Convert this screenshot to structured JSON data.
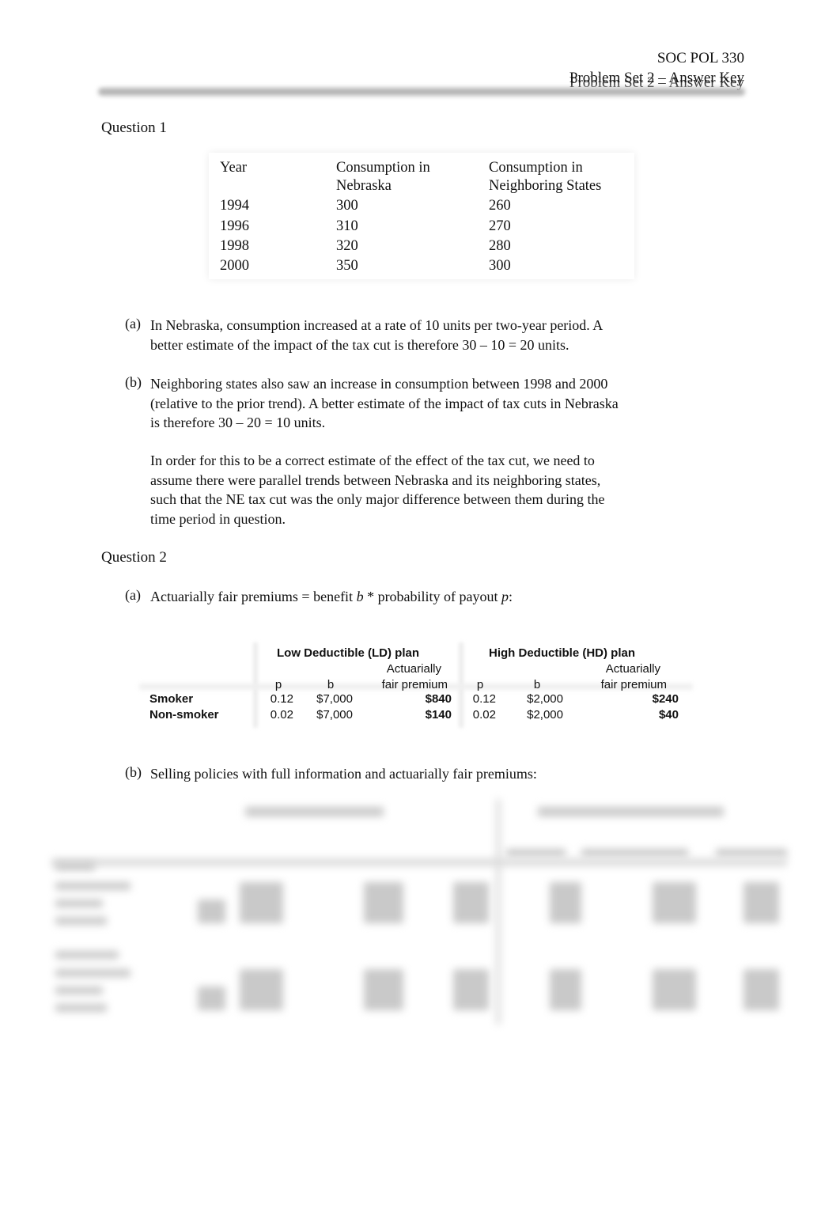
{
  "header": {
    "course": "SOC POL 330",
    "title": "Problem Set 2 – Answer Key"
  },
  "question1": {
    "heading": "Question 1",
    "table": {
      "columns": [
        "Year",
        "Consumption in\nNebraska",
        "Consumption in\nNeighboring States"
      ],
      "column_lines": [
        [
          "Year"
        ],
        [
          "Consumption in",
          "Nebraska"
        ],
        [
          "Consumption in",
          "Neighboring States"
        ]
      ],
      "rows": [
        [
          "1994",
          "300",
          "260"
        ],
        [
          "1996",
          "310",
          "270"
        ],
        [
          "1998",
          "320",
          "280"
        ],
        [
          "2000",
          "350",
          "300"
        ]
      ]
    },
    "part_a": {
      "label": "(a)",
      "lines": [
        "In Nebraska, consumption increased at a rate of 10 units per two-year period. A",
        "better estimate of the impact of the tax cut is therefore 30 – 10 = 20 units."
      ]
    },
    "part_b": {
      "label": "(b)",
      "lines": [
        "Neighboring states also saw an increase in consumption between 1998 and 2000",
        "(relative to the prior trend). A better estimate of the impact of tax cuts in Nebraska",
        "is therefore 30 – 20 = 10 units."
      ],
      "followup_lines": [
        "In order for this to be a correct estimate of the effect of the tax cut, we need to",
        "assume there were parallel trends between Nebraska and its neighboring states,",
        "such that the NE tax cut was the only major difference between them during the",
        "time period in question."
      ]
    }
  },
  "question2": {
    "heading": "Question 2",
    "part_a": {
      "label": "(a)",
      "text_pre": "Actuarially fair premiums = benefit ",
      "var_b": "b",
      "text_mid": " * probability of payout ",
      "var_p": "p",
      "text_post": ":"
    },
    "premium_table": {
      "groups": [
        "Low Deductible (LD) plan",
        "High Deductible (HD) plan"
      ],
      "subheaders": {
        "p": "p",
        "b": "b",
        "premium_line1": "Actuarially",
        "premium_line2": "fair premium"
      },
      "rows": [
        {
          "label": "Smoker",
          "ld": {
            "p": "0.12",
            "b": "$7,000",
            "premium": "$840"
          },
          "hd": {
            "p": "0.12",
            "b": "$2,000",
            "premium": "$240"
          }
        },
        {
          "label": "Non-smoker",
          "ld": {
            "p": "0.02",
            "b": "$7,000",
            "premium": "$140"
          },
          "hd": {
            "p": "0.02",
            "b": "$2,000",
            "premium": "$40"
          }
        }
      ]
    },
    "part_b": {
      "label": "(b)",
      "text": "Selling policies with full information and actuarially fair premiums:"
    }
  }
}
